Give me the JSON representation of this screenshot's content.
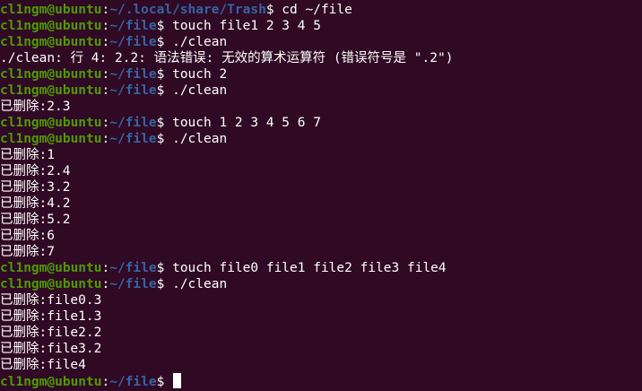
{
  "terminal": {
    "colors": {
      "background": "#300a24",
      "prompt_user": "#4e9a06",
      "prompt_path": "#3465a4",
      "text": "#ffffff"
    },
    "lines": [
      {
        "type": "prompt",
        "user": "cl1ngm@ubuntu",
        "path": "~/.local/share/Trash",
        "command": " cd ~/file"
      },
      {
        "type": "prompt",
        "user": "cl1ngm@ubuntu",
        "path": "~/file",
        "command": " touch file1 2 3 4 5"
      },
      {
        "type": "prompt",
        "user": "cl1ngm@ubuntu",
        "path": "~/file",
        "command": " ./clean"
      },
      {
        "type": "output",
        "text": "./clean: 行 4: 2.2: 语法错误: 无效的算术运算符 (错误符号是 \".2\")"
      },
      {
        "type": "prompt",
        "user": "cl1ngm@ubuntu",
        "path": "~/file",
        "command": " touch 2"
      },
      {
        "type": "prompt",
        "user": "cl1ngm@ubuntu",
        "path": "~/file",
        "command": " ./clean"
      },
      {
        "type": "output",
        "text": "已删除:2.3"
      },
      {
        "type": "prompt",
        "user": "cl1ngm@ubuntu",
        "path": "~/file",
        "command": " touch 1 2 3 4 5 6 7"
      },
      {
        "type": "prompt",
        "user": "cl1ngm@ubuntu",
        "path": "~/file",
        "command": " ./clean"
      },
      {
        "type": "output",
        "text": "已删除:1"
      },
      {
        "type": "output",
        "text": "已删除:2.4"
      },
      {
        "type": "output",
        "text": "已删除:3.2"
      },
      {
        "type": "output",
        "text": "已删除:4.2"
      },
      {
        "type": "output",
        "text": "已删除:5.2"
      },
      {
        "type": "output",
        "text": "已删除:6"
      },
      {
        "type": "output",
        "text": "已删除:7"
      },
      {
        "type": "prompt",
        "user": "cl1ngm@ubuntu",
        "path": "~/file",
        "command": " touch file0 file1 file2 file3 file4"
      },
      {
        "type": "prompt",
        "user": "cl1ngm@ubuntu",
        "path": "~/file",
        "command": " ./clean"
      },
      {
        "type": "output",
        "text": "已删除:file0.3"
      },
      {
        "type": "output",
        "text": "已删除:file1.3"
      },
      {
        "type": "output",
        "text": "已删除:file2.2"
      },
      {
        "type": "output",
        "text": "已删除:file3.2"
      },
      {
        "type": "output",
        "text": "已删除:file4"
      },
      {
        "type": "prompt",
        "user": "cl1ngm@ubuntu",
        "path": "~/file",
        "command": " ",
        "cursor": true
      }
    ]
  }
}
